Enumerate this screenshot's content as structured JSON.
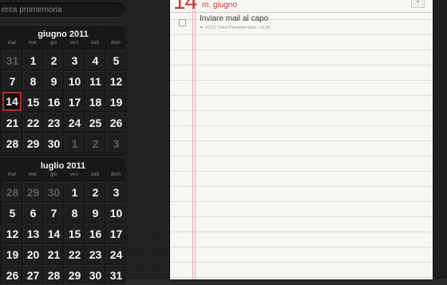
{
  "search": {
    "placeholder": "erca promemoria"
  },
  "calendars": [
    {
      "title": "giugno 2011",
      "weekdays": [
        "mar",
        "mer",
        "gio",
        "ven",
        "sab",
        "dom"
      ],
      "weeks": [
        [
          {
            "d": "31",
            "dim": true
          },
          {
            "d": "1"
          },
          {
            "d": "2"
          },
          {
            "d": "3"
          },
          {
            "d": "4"
          },
          {
            "d": "5"
          }
        ],
        [
          {
            "d": "7"
          },
          {
            "d": "8"
          },
          {
            "d": "9"
          },
          {
            "d": "10"
          },
          {
            "d": "11"
          },
          {
            "d": "12"
          }
        ],
        [
          {
            "d": "14",
            "today": true
          },
          {
            "d": "15"
          },
          {
            "d": "16"
          },
          {
            "d": "17"
          },
          {
            "d": "18"
          },
          {
            "d": "19"
          }
        ],
        [
          {
            "d": "21"
          },
          {
            "d": "22"
          },
          {
            "d": "23"
          },
          {
            "d": "24"
          },
          {
            "d": "25"
          },
          {
            "d": "26"
          }
        ],
        [
          {
            "d": "28"
          },
          {
            "d": "29"
          },
          {
            "d": "30"
          },
          {
            "d": "1",
            "dim": true
          },
          {
            "d": "2",
            "dim": true
          },
          {
            "d": "3",
            "dim": true
          }
        ]
      ]
    },
    {
      "title": "luglio 2011",
      "weekdays": [
        "mar",
        "mer",
        "gio",
        "ven",
        "sab",
        "dom"
      ],
      "weeks": [
        [
          {
            "d": "28",
            "dim": true
          },
          {
            "d": "29",
            "dim": true
          },
          {
            "d": "30",
            "dim": true
          },
          {
            "d": "1"
          },
          {
            "d": "2"
          },
          {
            "d": "3"
          }
        ],
        [
          {
            "d": "5"
          },
          {
            "d": "6"
          },
          {
            "d": "7"
          },
          {
            "d": "8"
          },
          {
            "d": "9"
          },
          {
            "d": "10"
          }
        ],
        [
          {
            "d": "12"
          },
          {
            "d": "13"
          },
          {
            "d": "14"
          },
          {
            "d": "15"
          },
          {
            "d": "16"
          },
          {
            "d": "17"
          }
        ],
        [
          {
            "d": "19"
          },
          {
            "d": "20"
          },
          {
            "d": "21"
          },
          {
            "d": "22"
          },
          {
            "d": "23"
          },
          {
            "d": "24"
          }
        ],
        [
          {
            "d": "26"
          },
          {
            "d": "27"
          },
          {
            "d": "28"
          },
          {
            "d": "29"
          },
          {
            "d": "30"
          },
          {
            "d": "31"
          }
        ]
      ]
    }
  ],
  "notepad": {
    "day_number": "14",
    "month_label": "m. giugno",
    "add_label": "+",
    "reminders": [
      {
        "title": "Inviare mail al capo",
        "meta": "10122 Torino Piemonte Italia  –  10:00",
        "icon": "location-arrow-icon"
      }
    ]
  },
  "colors": {
    "accent": "#c8343b",
    "today_border": "#c1272d"
  }
}
